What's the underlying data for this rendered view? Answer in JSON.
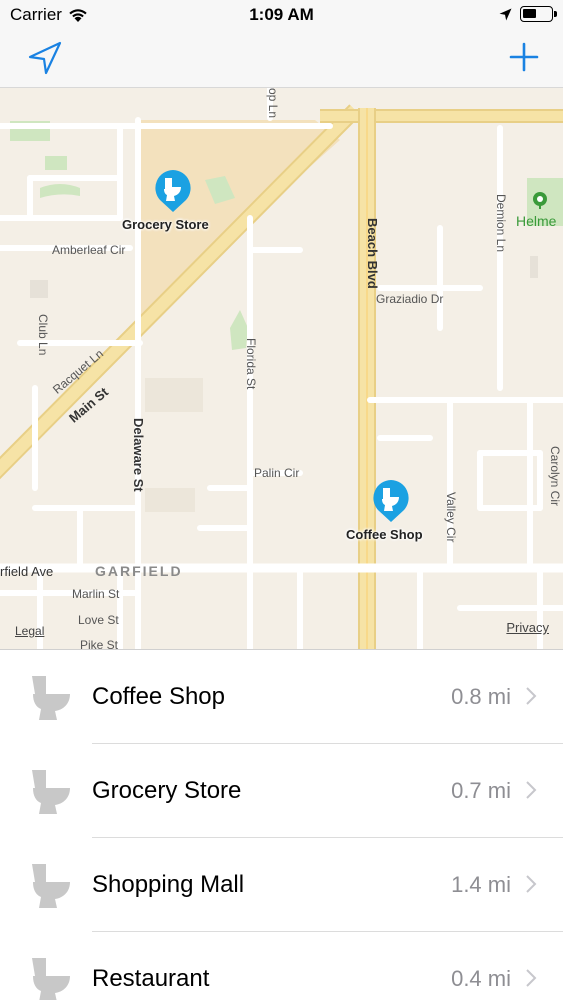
{
  "status_bar": {
    "carrier": "Carrier",
    "time": "1:09 AM"
  },
  "nav": {
    "location_icon": "location-arrow-icon",
    "add_icon": "plus-icon"
  },
  "map": {
    "pins": [
      {
        "label": "Grocery Store"
      },
      {
        "label": "Coffee Shop"
      }
    ],
    "streets": {
      "amberleaf": "Amberleaf Cir",
      "club": "Club Ln",
      "racquet": "Racquet Ln",
      "main": "Main St",
      "delaware": "Delaware St",
      "florida": "Florida St",
      "palin": "Palin Cir",
      "beach": "Beach Blvd",
      "graziadio": "Graziadio Dr",
      "demion": "Demion Ln",
      "valley": "Valley Cir",
      "carolyn": "Carolyn Cir",
      "garfield_ave": "rfield Ave",
      "marlin": "Marlin St",
      "love": "Love St",
      "pike": "Pike St",
      "top_ln": "op Ln"
    },
    "area_label": "GARFIELD",
    "park_label": "Helme",
    "legal": "Legal",
    "privacy": "Privacy"
  },
  "places": [
    {
      "name": "Coffee Shop",
      "distance": "0.8 mi"
    },
    {
      "name": "Grocery Store",
      "distance": "0.7 mi"
    },
    {
      "name": "Shopping Mall",
      "distance": "1.4 mi"
    },
    {
      "name": "Restaurant",
      "distance": "0.4 mi"
    }
  ],
  "colors": {
    "accent": "#1a82e2",
    "pin": "#1ba1e2",
    "road_major": "#f6d77e"
  }
}
